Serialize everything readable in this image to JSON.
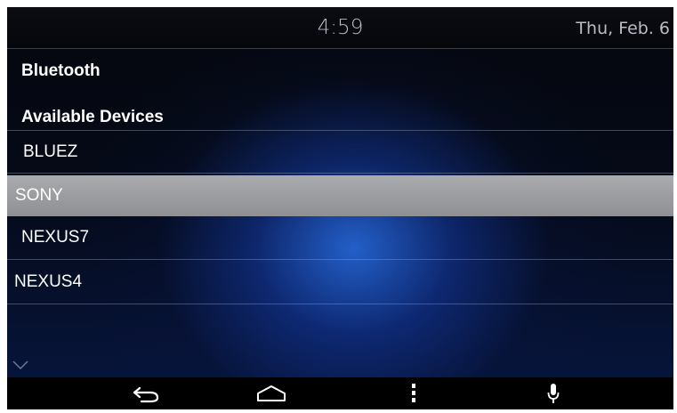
{
  "status_bar": {
    "time": "4:59",
    "date": "Thu, Feb. 6"
  },
  "bluetooth": {
    "title": "Bluetooth",
    "section_header": "Available Devices",
    "devices": [
      {
        "label": "BLUEZ",
        "selected": false
      },
      {
        "label": "SONY",
        "selected": true
      },
      {
        "label": "NEXUS7",
        "selected": false
      },
      {
        "label": "NEXUS4",
        "selected": false
      }
    ]
  },
  "nav_bar": {
    "buttons": [
      {
        "icon": "back-icon"
      },
      {
        "icon": "home-icon"
      },
      {
        "icon": "menu-icon"
      },
      {
        "icon": "microphone-icon"
      }
    ]
  },
  "colors": {
    "selected_row": "#9b9da0",
    "background_glow": "#286ee6",
    "text": "#ffffff",
    "status_text": "#b9bcc4"
  }
}
